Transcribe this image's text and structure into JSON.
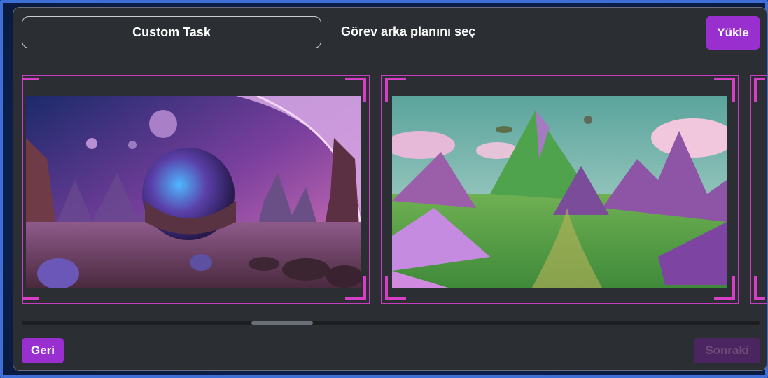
{
  "header": {
    "task_title": "Custom Task",
    "instruction": "Görev arka planını seç",
    "upload_label": "Yükle"
  },
  "backgrounds": [
    {
      "id": "alien-planet-landscape",
      "icon": "alien-planet-landscape-image"
    },
    {
      "id": "purple-green-mountains",
      "icon": "purple-green-mountains-image"
    },
    {
      "id": "partial-next-card",
      "icon": "card-frame"
    }
  ],
  "footer": {
    "back_label": "Geri",
    "next_label": "Sonraki"
  },
  "colors": {
    "accent": "#9a2fcf",
    "accent_disabled": "#4b2560",
    "card_border": "#c63dbf",
    "panel_bg": "#2b2e33"
  },
  "scroll": {
    "position": 0.34
  }
}
